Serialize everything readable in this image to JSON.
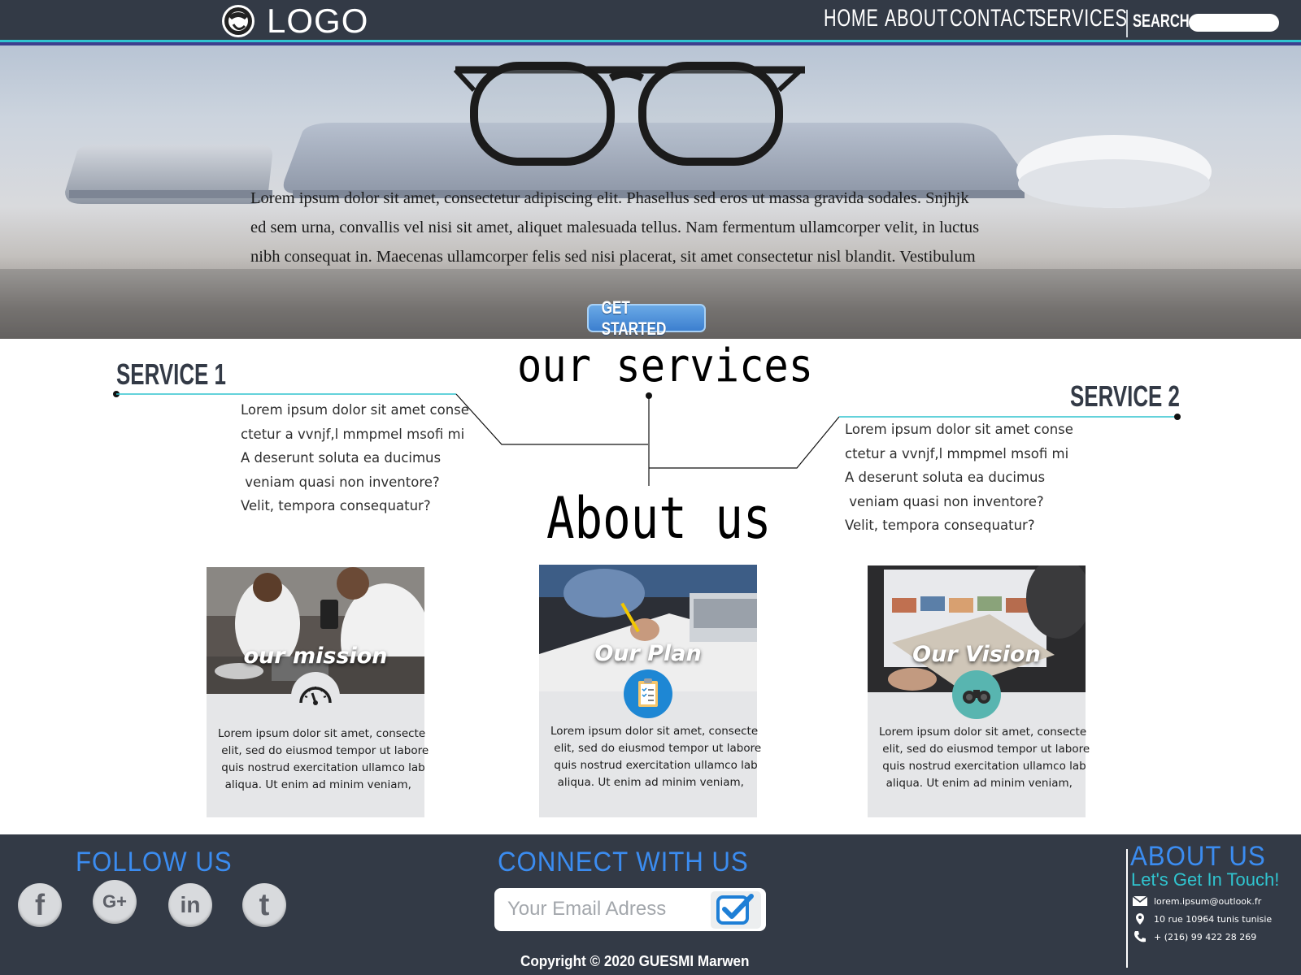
{
  "header": {
    "logo_text": "LOGO",
    "nav": [
      "HOME",
      "ABOUT",
      "CONTACT",
      "SERVICES"
    ],
    "search_label": "SEARCH",
    "search_placeholder": ""
  },
  "hero": {
    "lines": [
      "Lorem ipsum dolor sit amet, consectetur adipiscing elit. Phasellus sed eros ut massa gravida sodales. Snjhjk",
      "ed sem urna, convallis vel nisi sit amet, aliquet malesuada tellus. Nam fermentum ullamcorper velit, in luctus",
      "nibh consequat in. Maecenas ullamcorper felis sed nisi placerat, sit amet consectetur nisl blandit. Vestibulum"
    ],
    "cta_label": "GET STARTED"
  },
  "services": {
    "title": "our services",
    "items": [
      {
        "title": "SERVICE 1",
        "lines": [
          "Lorem ipsum dolor sit amet conse",
          "ctetur a vvnjf,l mmpmel msofi mi",
          "A deserunt soluta ea ducimus",
          " veniam quasi non inventore?",
          "Velit, tempora consequatur?"
        ]
      },
      {
        "title": "SERVICE 2",
        "lines": [
          "Lorem ipsum dolor sit amet conse",
          "ctetur a vvnjf,l mmpmel msofi mi",
          "A deserunt soluta ea ducimus",
          " veniam quasi non inventore?",
          "Velit, tempora consequatur?"
        ]
      }
    ]
  },
  "about": {
    "title": "About us",
    "cards": [
      {
        "label": "our mission",
        "icon": "speedometer-icon",
        "lines": [
          "Lorem ipsum dolor sit amet, consecte",
          " elit, sed do eiusmod tempor ut labore",
          " quis nostrud exercitation ullamco lab",
          "  aliqua. Ut enim ad minim veniam,"
        ]
      },
      {
        "label": "Our Plan",
        "icon": "clipboard-checklist-icon",
        "lines": [
          "Lorem ipsum dolor sit amet, consecte",
          " elit, sed do eiusmod tempor ut labore",
          " quis nostrud exercitation ullamco lab",
          "  aliqua. Ut enim ad minim veniam,"
        ]
      },
      {
        "label": "Our Vision",
        "icon": "binoculars-icon",
        "lines": [
          "Lorem ipsum dolor sit amet, consecte",
          " elit, sed do eiusmod tempor ut labore",
          " quis nostrud exercitation ullamco lab",
          "  aliqua. Ut enim ad minim veniam,"
        ]
      }
    ]
  },
  "footer": {
    "follow_title": "FOLLOW US",
    "social": [
      {
        "name": "facebook-icon",
        "glyph": "f"
      },
      {
        "name": "google-plus-icon",
        "glyph": "G+"
      },
      {
        "name": "linkedin-icon",
        "glyph": "in"
      },
      {
        "name": "tumblr-icon",
        "glyph": "t"
      }
    ],
    "connect_title": "CONNECT WITH US",
    "email_placeholder": "Your Email Adress",
    "copyright": "Copyright © 2020 GUESMI Marwen",
    "about_title": "ABOUT US",
    "touch": "Let's Get In Touch!",
    "email": "lorem.ipsum@outlook.fr",
    "address": "10 rue 10964 tunis tunisie",
    "phone": "+ (216) 99 422 28 269"
  },
  "colors": {
    "header_bg": "#333a46",
    "accent_teal": "#30c4cf",
    "accent_blue": "#3b8cf0",
    "card_bg": "#e5e6e8"
  }
}
